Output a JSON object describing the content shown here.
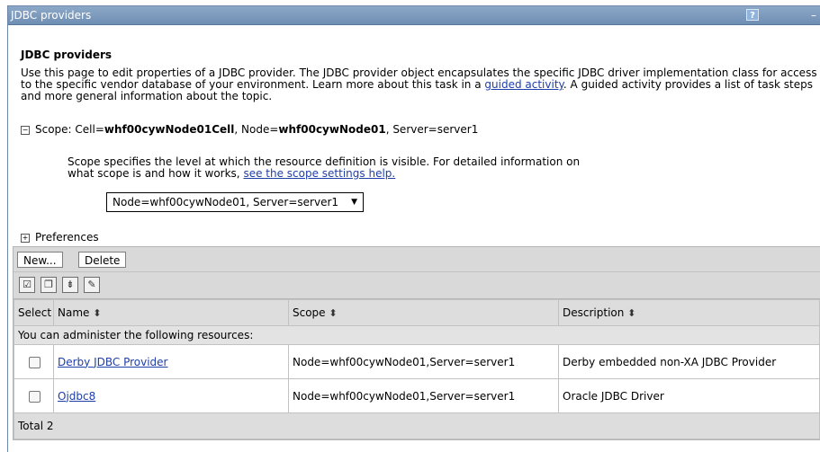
{
  "window": {
    "title": "JDBC providers",
    "help_label": "?",
    "minimize_label": "–"
  },
  "page": {
    "heading": "JDBC providers",
    "intro_part1": "Use this page to edit properties of a JDBC provider. The JDBC provider object encapsulates the specific JDBC driver implementation class for access to the specific vendor database of your environment. Learn more about this task in a ",
    "intro_link": "guided activity",
    "intro_part2": ". A guided activity provides a list of task steps and more general information about the topic."
  },
  "scope": {
    "expander": "−",
    "prefix": "Scope: Cell=",
    "cell": "whf00cywNode01Cell",
    "node_label": ", Node=",
    "node": "whf00cywNode01",
    "server_label": ", Server=server1",
    "description": "Scope specifies the level at which the resource definition is visible. For detailed information on",
    "description2": "what scope is and how it works, ",
    "help_link": "see the scope settings help.",
    "selected": "Node=whf00cywNode01, Server=server1",
    "arrow": "▼"
  },
  "preferences": {
    "expander": "+",
    "label": "Preferences"
  },
  "toolbar": {
    "new_label": "New...",
    "delete_label": "Delete"
  },
  "table": {
    "headers": {
      "select": "Select",
      "name": "Name",
      "scope": "Scope",
      "description": "Description",
      "sort_icon": "⬍"
    },
    "info": "You can administer the following resources:",
    "rows": [
      {
        "name": "Derby JDBC Provider",
        "scope": "Node=whf00cywNode01,Server=server1",
        "description": "Derby embedded non-XA JDBC Provider"
      },
      {
        "name": "Ojdbc8",
        "scope": "Node=whf00cywNode01,Server=server1",
        "description": "Oracle JDBC Driver"
      }
    ],
    "total": "Total 2"
  }
}
